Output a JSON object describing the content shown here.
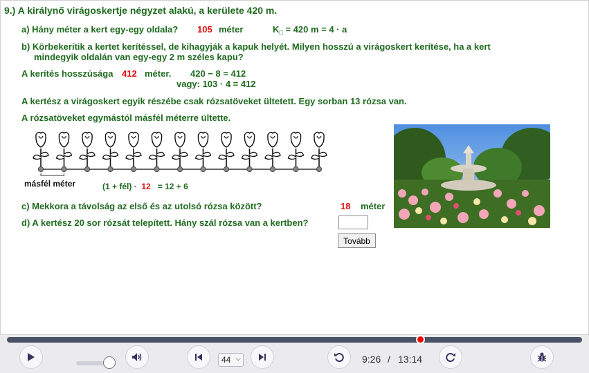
{
  "problem": {
    "title": "9.) A királynő virágoskertje négyzet alakú, a kerülete 420 m.",
    "qa_text": "a)  Hány méter a kert egy-egy oldala?",
    "qa_answer": "105",
    "qa_unit": "méter",
    "qa_formula_k": "K",
    "qa_formula_sub": "□",
    "qa_formula_rest": " = 420 m = 4  ·  a",
    "qb_line1": "b)  Körbekerítik a kertet kerítéssel, de kihagyják a kapuk helyét. Milyen hosszú a virágoskert kerítése, ha a kert",
    "qb_line2": "mindegyik oldalán van egy-egy 2 m széles kapu?",
    "fence_label": "A kerítés hosszúsága",
    "fence_value": "412",
    "fence_unit": "méter.",
    "fence_calc1": "420  −  8  =  412",
    "fence_calc2": "vagy: 103  ·  4  =  412",
    "para1": "A kertész a virágoskert egyik részébe csak rózsatöveket ültetett. Egy sorban 13 rózsa van.",
    "para2": "A rózsatöveket egymástól másfél méterre ültette.",
    "masfel_label": "másfél méter",
    "calc_left": "(1  +  fél)  ·",
    "calc_mid": "12",
    "calc_right": "=  12  +  6",
    "qc_text": "c)  Mekkora a távolság az első és az utolsó rózsa között?",
    "qc_answer": "18",
    "qc_unit": "méter",
    "qd_text": "d)  A kertész 20 sor rózsát telepített. Hány szál rózsa van a kertben?",
    "qd_input_value": "",
    "tovabb_label": "Tovább",
    "rose_count": 13
  },
  "player": {
    "progress_fraction": 0.719,
    "volume_fraction": 0.85,
    "speed_value": "44",
    "current_time": "9:26",
    "separator": "/",
    "total_time": "13:14"
  },
  "colors": {
    "text_green": "#1f6b1f",
    "answer_red": "#e01010",
    "progress_track": "#4a5366",
    "progress_knob": "#ee0000",
    "icon_purple": "#3a3060"
  },
  "icons": {
    "play": "play-icon",
    "volume": "volume-icon",
    "prev": "skip-back-icon",
    "next": "skip-forward-icon",
    "rewind": "rewind-icon",
    "forward": "forward-icon",
    "bug": "bug-icon"
  }
}
